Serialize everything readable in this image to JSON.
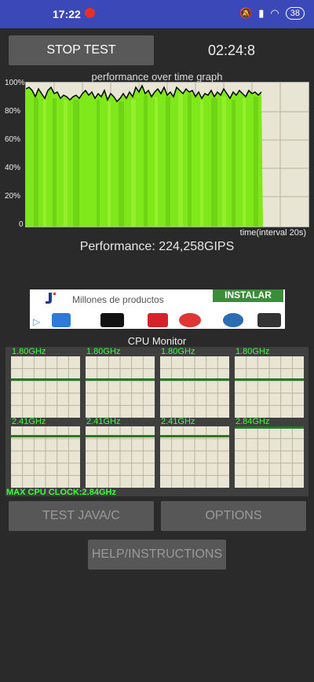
{
  "status": {
    "time": "17:22",
    "battery": "38"
  },
  "controls": {
    "stop_label": "STOP TEST",
    "timer": "02:24:8"
  },
  "graph": {
    "title": "performance over time graph",
    "y_ticks": [
      "100%",
      "80%",
      "60%",
      "40%",
      "20%",
      "0"
    ],
    "x_label": "time(interval 20s)",
    "performance_text": "Performance: 224,258GIPS"
  },
  "ad": {
    "text": "Millones de productos",
    "button": "INSTALAR"
  },
  "cpu": {
    "title": "CPU Monitor",
    "cores": [
      {
        "freq": "1.80GHz",
        "level": 0.63
      },
      {
        "freq": "1.80GHz",
        "level": 0.63
      },
      {
        "freq": "1.80GHz",
        "level": 0.63
      },
      {
        "freq": "1.80GHz",
        "level": 0.63
      },
      {
        "freq": "2.41GHz",
        "level": 0.85
      },
      {
        "freq": "2.41GHz",
        "level": 0.85
      },
      {
        "freq": "2.41GHz",
        "level": 0.85
      },
      {
        "freq": "2.84GHz",
        "level": 1.0
      }
    ],
    "max_clock": "MAX CPU CLOCK:2.84GHz"
  },
  "buttons": {
    "java": "TEST JAVA/C",
    "options": "OPTIONS",
    "help": "HELP/INSTRUCTIONS"
  },
  "colors": {
    "status_bar": "#3b48b8",
    "graph_green": "#7ee81a",
    "cpu_green": "#3dff3d",
    "panel_bg": "#2a2a2a"
  }
}
